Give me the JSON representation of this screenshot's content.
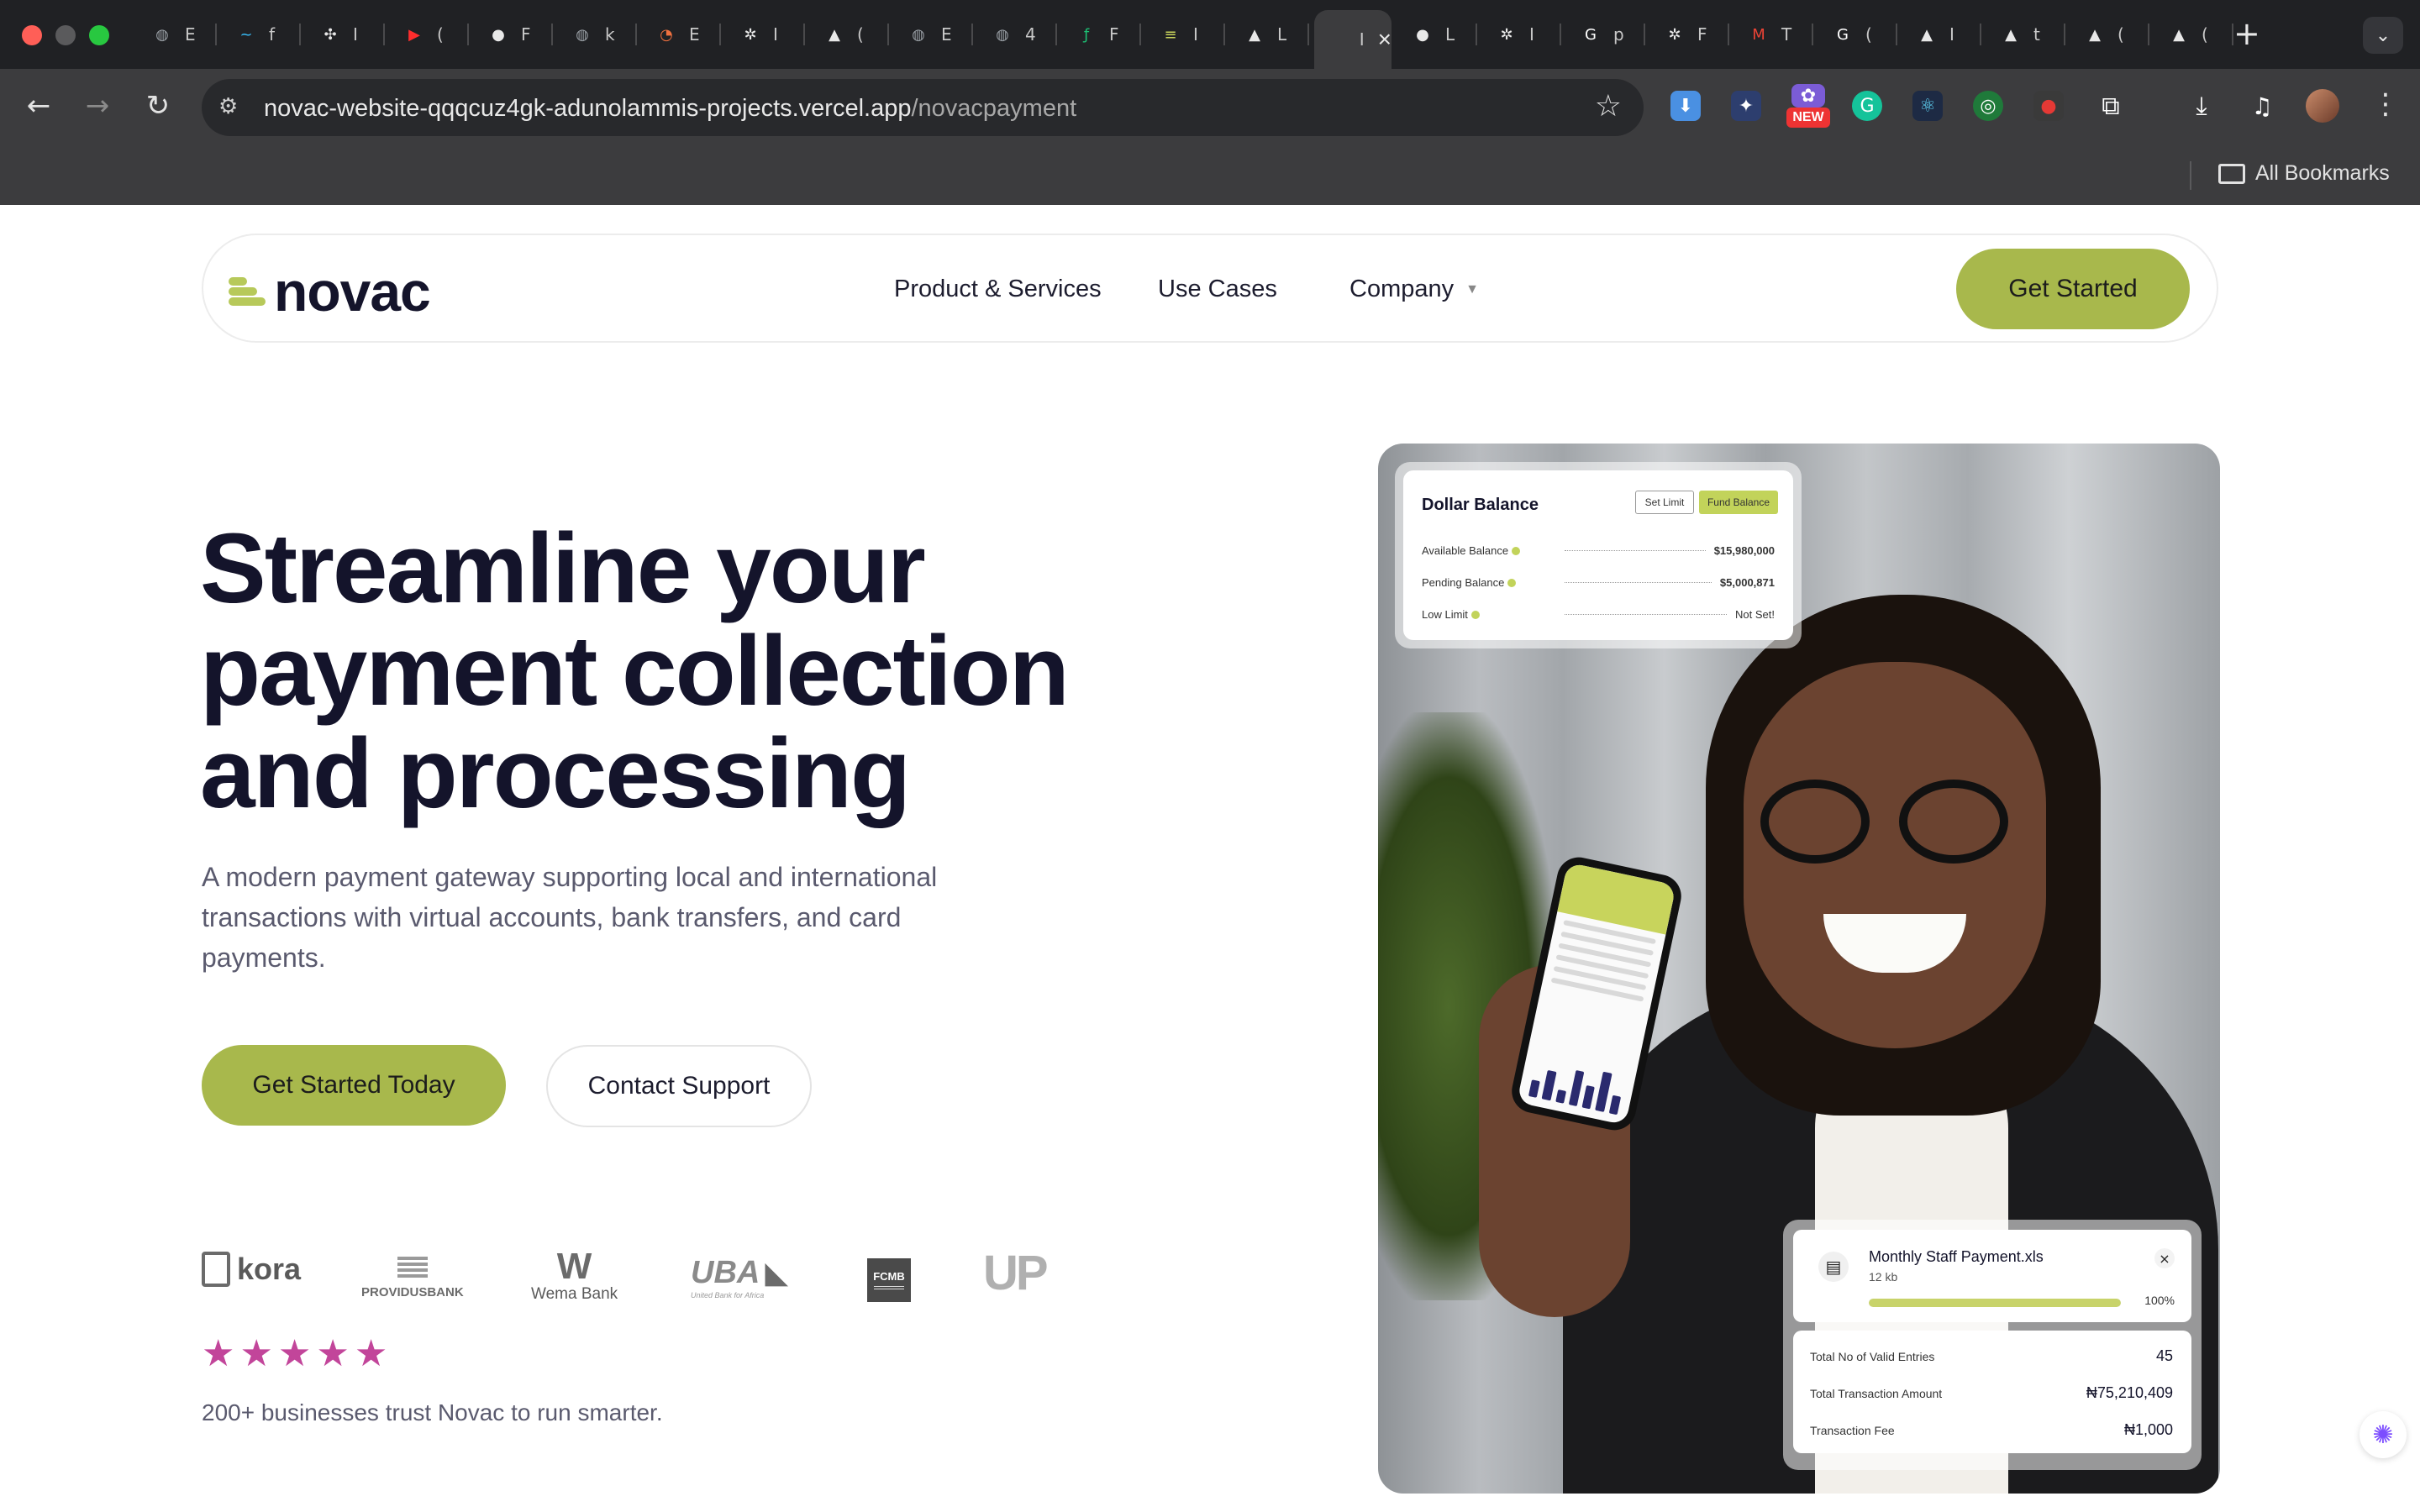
{
  "browser": {
    "tabs": [
      {
        "fav": "◍",
        "label": "E",
        "color": "#9aa0a6"
      },
      {
        "fav": "~",
        "label": "f",
        "color": "#38bdf8"
      },
      {
        "fav": "✣",
        "label": "I",
        "color": "#e8e8e8"
      },
      {
        "fav": "▶",
        "label": "(",
        "color": "#ff2d2d"
      },
      {
        "fav": "●",
        "label": "F",
        "color": "#e8e8e8"
      },
      {
        "fav": "◍",
        "label": "k",
        "color": "#9aa0a6"
      },
      {
        "fav": "◔",
        "label": "E",
        "color": "#f0713f"
      },
      {
        "fav": "✲",
        "label": "I",
        "color": "#e8e8e8"
      },
      {
        "fav": "▲",
        "label": "(",
        "color": "#e8e8e8"
      },
      {
        "fav": "◍",
        "label": "E",
        "color": "#9aa0a6"
      },
      {
        "fav": "◍",
        "label": "4",
        "color": "#9aa0a6"
      },
      {
        "fav": "ƒ",
        "label": "F",
        "color": "#1dbf73"
      },
      {
        "fav": "≡",
        "label": "I",
        "color": "#c8d45c"
      },
      {
        "fav": "▲",
        "label": "L",
        "color": "#e8e8e8"
      },
      {
        "fav": "",
        "label": "I",
        "color": "#e8e8e8"
      },
      {
        "fav": "●",
        "label": "L",
        "color": "#e8e8e8"
      },
      {
        "fav": "✲",
        "label": "I",
        "color": "#e8e8e8"
      },
      {
        "fav": "G",
        "label": "p",
        "color": "#ffffff"
      },
      {
        "fav": "✲",
        "label": "F",
        "color": "#e8e8e8"
      },
      {
        "fav": "M",
        "label": "T",
        "color": "#ea4335"
      },
      {
        "fav": "G",
        "label": "(",
        "color": "#ffffff"
      },
      {
        "fav": "▲",
        "label": "I",
        "color": "#e8e8e8"
      },
      {
        "fav": "▲",
        "label": "t",
        "color": "#e8e8e8"
      },
      {
        "fav": "▲",
        "label": "(",
        "color": "#e8e8e8"
      },
      {
        "fav": "▲",
        "label": "(",
        "color": "#e8e8e8"
      }
    ],
    "active_tab_index": 14,
    "url_host": "novac-website-qqqcuz4gk-adunolammis-projects.vercel.app",
    "url_path": "/novacpayment",
    "extension_new_badge": "NEW",
    "bookmarks_label": "All Bookmarks"
  },
  "nav": {
    "logo_text": "novac",
    "links": [
      "Product & Services",
      "Use Cases",
      "Company"
    ],
    "cta": "Get Started"
  },
  "hero": {
    "title_lines": [
      "Streamline your",
      "payment collection",
      "and processing"
    ],
    "description": "A modern payment gateway supporting local and international transactions with virtual accounts, bank transfers, and card payments.",
    "primary_cta": "Get Started Today",
    "secondary_cta": "Contact Support"
  },
  "partners": [
    {
      "name": "kora",
      "icon": "kora-logo"
    },
    {
      "name": "PROVIDUSBANK",
      "icon": "providus-logo"
    },
    {
      "name": "Wema Bank",
      "icon": "wema-logo"
    },
    {
      "name": "UBA",
      "sub": "United Bank for Africa",
      "icon": "uba-logo"
    },
    {
      "name": "FCMB",
      "icon": "fcmb-logo"
    },
    {
      "name": "UP",
      "icon": "up-logo"
    }
  ],
  "rating": {
    "stars": 5,
    "trust_text": "200+ businesses trust Novac to run smarter."
  },
  "balance_card": {
    "title": "Dollar Balance",
    "set_limit": "Set Limit",
    "fund_balance": "Fund Balance",
    "rows": [
      {
        "label": "Available Balance",
        "value": "$15,980,000"
      },
      {
        "label": "Pending Balance",
        "value": "$5,000,871"
      },
      {
        "label": "Low Limit",
        "value": "Not Set!"
      }
    ]
  },
  "upload_card": {
    "file_name": "Monthly Staff Payment.xls",
    "file_size": "12 kb",
    "progress_fraction": 1.0,
    "progress_label": "100%",
    "stats": [
      {
        "label": "Total No of Valid Entries",
        "value": "45"
      },
      {
        "label": "Total Transaction Amount",
        "value": "₦75,210,409"
      },
      {
        "label": "Transaction Fee",
        "value": "₦1,000"
      }
    ]
  },
  "colors": {
    "accent": "#a8b84c",
    "heading": "#14142b",
    "star": "#c2459a"
  }
}
